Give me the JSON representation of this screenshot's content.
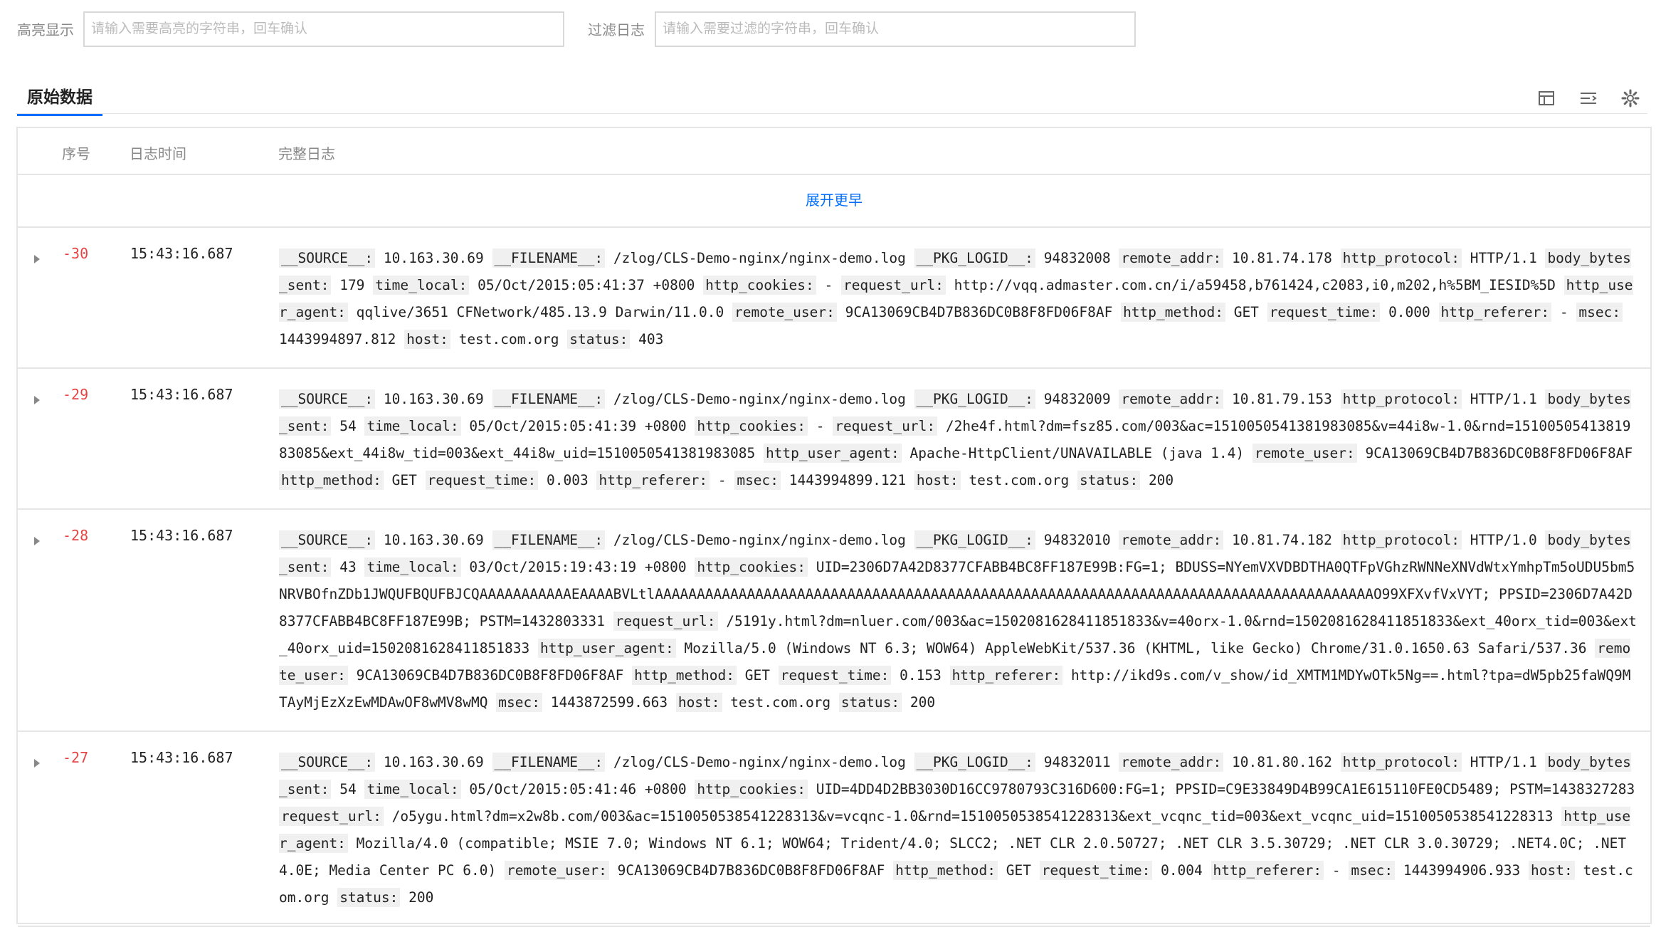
{
  "filters": {
    "highlight_label": "高亮显示",
    "highlight_placeholder": "请输入需要高亮的字符串，回车确认",
    "filter_label": "过滤日志",
    "filter_placeholder": "请输入需要过滤的字符串，回车确认"
  },
  "tabs": {
    "raw_data": "原始数据"
  },
  "toolbar": {
    "icons": [
      "layout-icon",
      "wrap-lines-icon",
      "settings-icon"
    ]
  },
  "table": {
    "headers": {
      "seq": "序号",
      "time": "日志时间",
      "log": "完整日志"
    },
    "expand_earlier": "展开更早",
    "rows": [
      {
        "seq": "-30",
        "time": "15:43:16.687",
        "fields": [
          {
            "k": "__SOURCE__:",
            "v": "10.163.30.69"
          },
          {
            "k": "__FILENAME__:",
            "v": "/zlog/CLS-Demo-nginx/nginx-demo.log"
          },
          {
            "k": "__PKG_LOGID__:",
            "v": "94832008"
          },
          {
            "k": "remote_addr:",
            "v": "10.81.74.178"
          },
          {
            "k": "http_protocol:",
            "v": "HTTP/1.1"
          },
          {
            "k": "body_bytes_sent:",
            "v": "179"
          },
          {
            "k": "time_local:",
            "v": "05/Oct/2015:05:41:37 +0800"
          },
          {
            "k": "http_cookies:",
            "v": "-"
          },
          {
            "k": "request_url:",
            "v": "http://vqq.admaster.com.cn/i/a59458,b761424,c2083,i0,m202,h%5BM_IESID%5D"
          },
          {
            "k": "http_user_agent:",
            "v": "qqlive/3651 CFNetwork/485.13.9 Darwin/11.0.0"
          },
          {
            "k": "remote_user:",
            "v": "9CA13069CB4D7B836DC0B8F8FD06F8AF"
          },
          {
            "k": "http_method:",
            "v": "GET"
          },
          {
            "k": "request_time:",
            "v": "0.000"
          },
          {
            "k": "http_referer:",
            "v": "-"
          },
          {
            "k": "msec:",
            "v": "1443994897.812"
          },
          {
            "k": "host:",
            "v": "test.com.org"
          },
          {
            "k": "status:",
            "v": "403"
          }
        ]
      },
      {
        "seq": "-29",
        "time": "15:43:16.687",
        "fields": [
          {
            "k": "__SOURCE__:",
            "v": "10.163.30.69"
          },
          {
            "k": "__FILENAME__:",
            "v": "/zlog/CLS-Demo-nginx/nginx-demo.log"
          },
          {
            "k": "__PKG_LOGID__:",
            "v": "94832009"
          },
          {
            "k": "remote_addr:",
            "v": "10.81.79.153"
          },
          {
            "k": "http_protocol:",
            "v": "HTTP/1.1"
          },
          {
            "k": "body_bytes_sent:",
            "v": "54"
          },
          {
            "k": "time_local:",
            "v": "05/Oct/2015:05:41:39 +0800"
          },
          {
            "k": "http_cookies:",
            "v": "-"
          },
          {
            "k": "request_url:",
            "v": "/2he4f.html?dm=fsz85.com/003&ac=1510050541381983085&v=44i8w-1.0&rnd=1510050541381983085&ext_44i8w_tid=003&ext_44i8w_uid=1510050541381983085"
          },
          {
            "k": "http_user_agent:",
            "v": "Apache-HttpClient/UNAVAILABLE (java 1.4)"
          },
          {
            "k": "remote_user:",
            "v": "9CA13069CB4D7B836DC0B8F8FD06F8AF"
          },
          {
            "k": "http_method:",
            "v": "GET"
          },
          {
            "k": "request_time:",
            "v": "0.003"
          },
          {
            "k": "http_referer:",
            "v": "-"
          },
          {
            "k": "msec:",
            "v": "1443994899.121"
          },
          {
            "k": "host:",
            "v": "test.com.org"
          },
          {
            "k": "status:",
            "v": "200"
          }
        ]
      },
      {
        "seq": "-28",
        "time": "15:43:16.687",
        "fields": [
          {
            "k": "__SOURCE__:",
            "v": "10.163.30.69"
          },
          {
            "k": "__FILENAME__:",
            "v": "/zlog/CLS-Demo-nginx/nginx-demo.log"
          },
          {
            "k": "__PKG_LOGID__:",
            "v": "94832010"
          },
          {
            "k": "remote_addr:",
            "v": "10.81.74.182"
          },
          {
            "k": "http_protocol:",
            "v": "HTTP/1.0"
          },
          {
            "k": "body_bytes_sent:",
            "v": "43"
          },
          {
            "k": "time_local:",
            "v": "03/Oct/2015:19:43:19 +0800"
          },
          {
            "k": "http_cookies:",
            "v": "UID=2306D7A42D8377CFABB4BC8FF187E99B:FG=1; BDUSS=NYemVXVDBDTHA0QTFpVGhzRWNNeXNVdWtxYmhpTm5oUDU5bm5NRVBOfnZDb1JWQUFBQUFBJCQAAAAAAAAAAAEAAAABVLtlAAAAAAAAAAAAAAAAAAAAAAAAAAAAAAAAAAAAAAAAAAAAAAAAAAAAAAAAAAAAAAAAAAAAAAAAAAAAAAAAAAAAAAO99XFXvfVxVYT; PPSID=2306D7A42D8377CFABB4BC8FF187E99B; PSTM=1432803331"
          },
          {
            "k": "request_url:",
            "v": "/5191y.html?dm=nluer.com/003&ac=1502081628411851833&v=40orx-1.0&rnd=1502081628411851833&ext_40orx_tid=003&ext_40orx_uid=1502081628411851833"
          },
          {
            "k": "http_user_agent:",
            "v": "Mozilla/5.0 (Windows NT 6.3; WOW64) AppleWebKit/537.36 (KHTML, like Gecko) Chrome/31.0.1650.63 Safari/537.36"
          },
          {
            "k": "remote_user:",
            "v": "9CA13069CB4D7B836DC0B8F8FD06F8AF"
          },
          {
            "k": "http_method:",
            "v": "GET"
          },
          {
            "k": "request_time:",
            "v": "0.153"
          },
          {
            "k": "http_referer:",
            "v": "http://ikd9s.com/v_show/id_XMTM1MDYwOTk5Ng==.html?tpa=dW5pb25faWQ9MTAyMjEzXzEwMDAwOF8wMV8wMQ"
          },
          {
            "k": "msec:",
            "v": "1443872599.663"
          },
          {
            "k": "host:",
            "v": "test.com.org"
          },
          {
            "k": "status:",
            "v": "200"
          }
        ]
      },
      {
        "seq": "-27",
        "time": "15:43:16.687",
        "fields": [
          {
            "k": "__SOURCE__:",
            "v": "10.163.30.69"
          },
          {
            "k": "__FILENAME__:",
            "v": "/zlog/CLS-Demo-nginx/nginx-demo.log"
          },
          {
            "k": "__PKG_LOGID__:",
            "v": "94832011"
          },
          {
            "k": "remote_addr:",
            "v": "10.81.80.162"
          },
          {
            "k": "http_protocol:",
            "v": "HTTP/1.1"
          },
          {
            "k": "body_bytes_sent:",
            "v": "54"
          },
          {
            "k": "time_local:",
            "v": "05/Oct/2015:05:41:46 +0800"
          },
          {
            "k": "http_cookies:",
            "v": "UID=4DD4D2BB3030D16CC9780793C316D600:FG=1; PPSID=C9E33849D4B99CA1E615110FE0CD5489; PSTM=1438327283"
          },
          {
            "k": "request_url:",
            "v": "/o5ygu.html?dm=x2w8b.com/003&ac=1510050538541228313&v=vcqnc-1.0&rnd=1510050538541228313&ext_vcqnc_tid=003&ext_vcqnc_uid=1510050538541228313"
          },
          {
            "k": "http_user_agent:",
            "v": "Mozilla/4.0 (compatible; MSIE 7.0; Windows NT 6.1; WOW64; Trident/4.0; SLCC2; .NET CLR 2.0.50727; .NET CLR 3.5.30729; .NET CLR 3.0.30729; .NET4.0C; .NET4.0E; Media Center PC 6.0)"
          },
          {
            "k": "remote_user:",
            "v": "9CA13069CB4D7B836DC0B8F8FD06F8AF"
          },
          {
            "k": "http_method:",
            "v": "GET"
          },
          {
            "k": "request_time:",
            "v": "0.004"
          },
          {
            "k": "http_referer:",
            "v": "-"
          },
          {
            "k": "msec:",
            "v": "1443994906.933"
          },
          {
            "k": "host:",
            "v": "test.com.org"
          },
          {
            "k": "status:",
            "v": "200"
          }
        ]
      }
    ]
  }
}
